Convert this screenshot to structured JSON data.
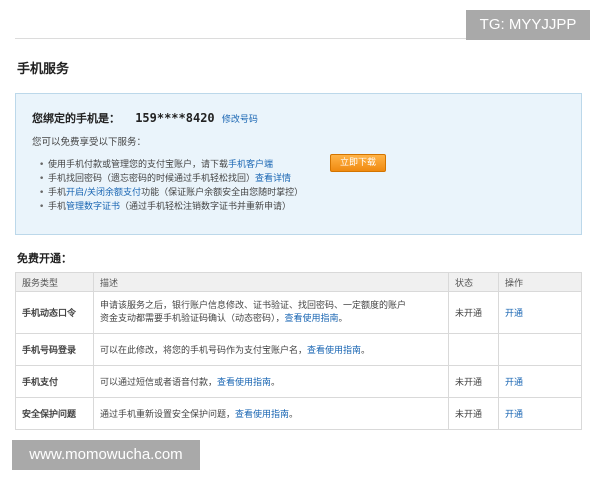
{
  "overlay": {
    "tg_badge": "TG: MYYJJPP",
    "watermark": "www.momowucha.com"
  },
  "page": {
    "title": "手机服务"
  },
  "binding": {
    "label": "您绑定的手机是：",
    "phone": "159****8420",
    "modify_link": "修改号码",
    "enjoy_text": "您可以免费享受以下服务：",
    "download_button": "立即下载",
    "benefits": [
      {
        "text": "使用手机付款或管理您的支付宝账户，请下载",
        "link": "手机客户端"
      },
      {
        "text": "手机找回密码（遗忘密码的时候通过手机轻松找回）",
        "link": "查看详情"
      },
      {
        "prefix": "手机",
        "link": "开启/关闭余额支付",
        "suffix": "功能（保证账户余额安全由您随时掌控）"
      },
      {
        "prefix": "手机",
        "link": "管理数字证书",
        "suffix": "（通过手机轻松注销数字证书并重新申请）"
      }
    ]
  },
  "free": {
    "title": "免费开通："
  },
  "table": {
    "headers": [
      "服务类型",
      "描述",
      "状态",
      "操作"
    ],
    "rows": [
      {
        "name": "手机动态口令",
        "desc_line1": "申请该服务之后，银行账户信息修改、证书验证、找回密码、一定额度的账户",
        "desc_line2": "资金支动都需要手机验证码确认（动态密码），",
        "desc_link": "查看使用指南",
        "desc_end": "。",
        "status": "未开通",
        "action": "开通"
      },
      {
        "name": "手机号码登录",
        "desc_line1": "可以在此修改，将您的手机号码作为支付宝账户名，",
        "desc_line2": "",
        "desc_link": "查看使用指南",
        "desc_end": "。",
        "status": "",
        "action": ""
      },
      {
        "name": "手机支付",
        "desc_line1": "可以通过短信或者语音付款，",
        "desc_line2": "",
        "desc_link": "查看使用指南",
        "desc_end": "。",
        "status": "未开通",
        "action": "开通"
      },
      {
        "name": "安全保护问题",
        "desc_line1": "通过手机重新设置安全保护问题，",
        "desc_line2": "",
        "desc_link": "查看使用指南",
        "desc_end": "。",
        "status": "未开通",
        "action": "开通"
      }
    ]
  }
}
